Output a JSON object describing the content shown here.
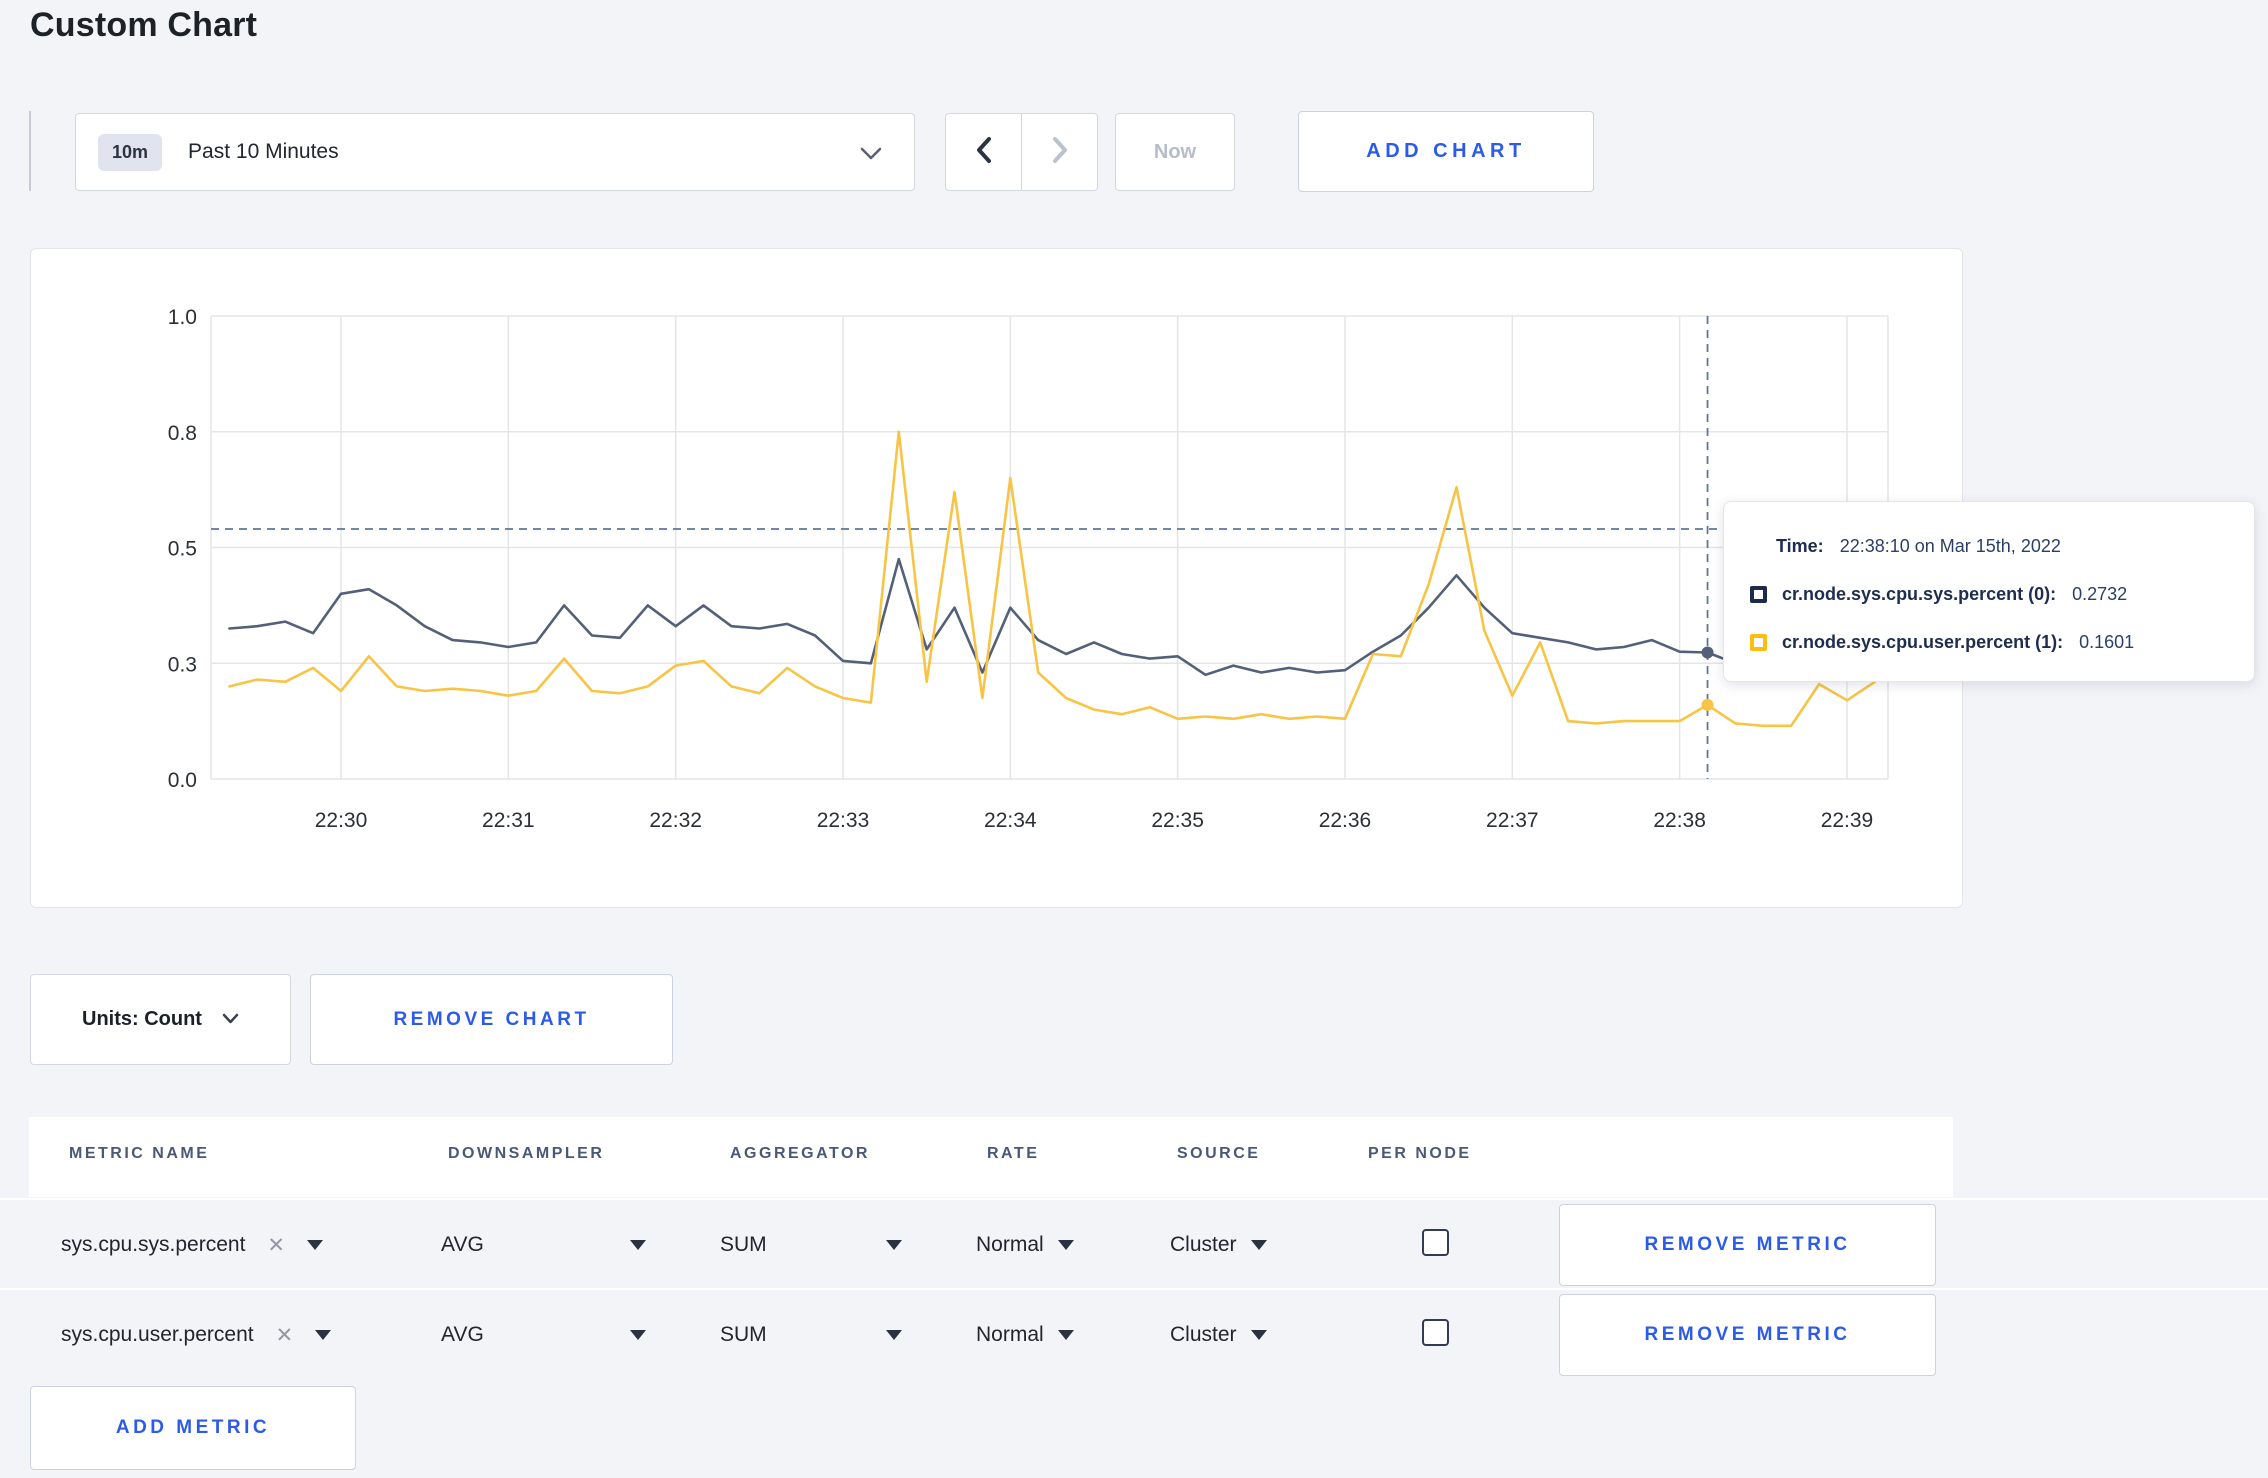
{
  "header": {
    "title": "Custom Chart"
  },
  "toolbar": {
    "range_badge": "10m",
    "range_label": "Past 10 Minutes",
    "now_label": "Now",
    "add_chart_label": "ADD CHART"
  },
  "chart_actions": {
    "units_label": "Units: Count",
    "remove_chart_label": "REMOVE CHART",
    "add_metric_label": "ADD METRIC"
  },
  "tooltip": {
    "time_label": "Time:",
    "time_value": "22:38:10 on Mar 15th, 2022",
    "rows": [
      {
        "name": "cr.node.sys.cpu.sys.percent (0):",
        "value": "0.2732",
        "color": "#1c2b4d"
      },
      {
        "name": "cr.node.sys.cpu.user.percent (1):",
        "value": "0.1601",
        "color": "#fdbe10"
      }
    ]
  },
  "metrics_table": {
    "columns": [
      "METRIC NAME",
      "DOWNSAMPLER",
      "AGGREGATOR",
      "RATE",
      "SOURCE",
      "PER NODE"
    ],
    "remove_metric_label": "REMOVE METRIC",
    "rows": [
      {
        "metric": "sys.cpu.sys.percent",
        "remove_symbol": "✕",
        "downsampler": "AVG",
        "aggregator": "SUM",
        "rate": "Normal",
        "source": "Cluster",
        "per_node_checked": false
      },
      {
        "metric": "sys.cpu.user.percent",
        "remove_symbol": "✕",
        "downsampler": "AVG",
        "aggregator": "SUM",
        "rate": "Normal",
        "source": "Cluster",
        "per_node_checked": false
      }
    ]
  },
  "chart_data": {
    "type": "line",
    "title": "",
    "xlabel": "",
    "ylabel": "",
    "grid": true,
    "legend": "tooltip-only",
    "ylim": [
      0,
      1
    ],
    "y_ticks": [
      {
        "label": "0.0",
        "value": 0
      },
      {
        "label": "0.3",
        "value": 0.25
      },
      {
        "label": "0.5",
        "value": 0.5
      },
      {
        "label": "0.8",
        "value": 0.75
      },
      {
        "label": "1.0",
        "value": 1
      }
    ],
    "x_start_time": "22:29:20",
    "x_interval_s": 10,
    "x_ticks": [
      {
        "label": "22:30",
        "offset_s": 40
      },
      {
        "label": "22:31",
        "offset_s": 100
      },
      {
        "label": "22:32",
        "offset_s": 160
      },
      {
        "label": "22:33",
        "offset_s": 220
      },
      {
        "label": "22:34",
        "offset_s": 280
      },
      {
        "label": "22:35",
        "offset_s": 340
      },
      {
        "label": "22:36",
        "offset_s": 400
      },
      {
        "label": "22:37",
        "offset_s": 460
      },
      {
        "label": "22:38",
        "offset_s": 520
      },
      {
        "label": "22:39",
        "offset_s": 580
      }
    ],
    "series": [
      {
        "name": "cr.node.sys.cpu.sys.percent (0)",
        "color": "#546078",
        "values": [
          0.325,
          0.33,
          0.34,
          0.315,
          0.4,
          0.41,
          0.375,
          0.33,
          0.3,
          0.295,
          0.285,
          0.295,
          0.375,
          0.31,
          0.305,
          0.375,
          0.33,
          0.375,
          0.33,
          0.325,
          0.335,
          0.31,
          0.255,
          0.25,
          0.475,
          0.28,
          0.37,
          0.23,
          0.37,
          0.3,
          0.27,
          0.295,
          0.27,
          0.26,
          0.265,
          0.225,
          0.245,
          0.23,
          0.24,
          0.23,
          0.235,
          0.275,
          0.31,
          0.37,
          0.44,
          0.37,
          0.315,
          0.305,
          0.295,
          0.28,
          0.285,
          0.3,
          0.275,
          0.2732,
          0.25,
          0.265,
          0.275,
          0.28,
          0.275,
          0.28
        ]
      },
      {
        "name": "cr.node.sys.cpu.user.percent (1)",
        "color": "#f8c445",
        "values": [
          0.2,
          0.215,
          0.21,
          0.24,
          0.19,
          0.265,
          0.2,
          0.19,
          0.195,
          0.19,
          0.18,
          0.19,
          0.26,
          0.19,
          0.185,
          0.2,
          0.245,
          0.255,
          0.2,
          0.185,
          0.24,
          0.2,
          0.175,
          0.165,
          0.75,
          0.21,
          0.62,
          0.175,
          0.65,
          0.23,
          0.175,
          0.15,
          0.14,
          0.155,
          0.13,
          0.135,
          0.13,
          0.14,
          0.13,
          0.135,
          0.13,
          0.27,
          0.265,
          0.42,
          0.63,
          0.32,
          0.18,
          0.295,
          0.125,
          0.12,
          0.125,
          0.125,
          0.125,
          0.1601,
          0.12,
          0.115,
          0.115,
          0.205,
          0.17,
          0.21
        ]
      }
    ],
    "crosshair": {
      "time": "22:38:10",
      "offset_s": 530,
      "hline_value": 0.54,
      "color": "#5f7699",
      "points": [
        {
          "series": 0,
          "value": 0.2732
        },
        {
          "series": 1,
          "value": 0.1601
        }
      ]
    },
    "grid_color": "#e4e5e8",
    "axis_label_color": "#2b2f36"
  }
}
